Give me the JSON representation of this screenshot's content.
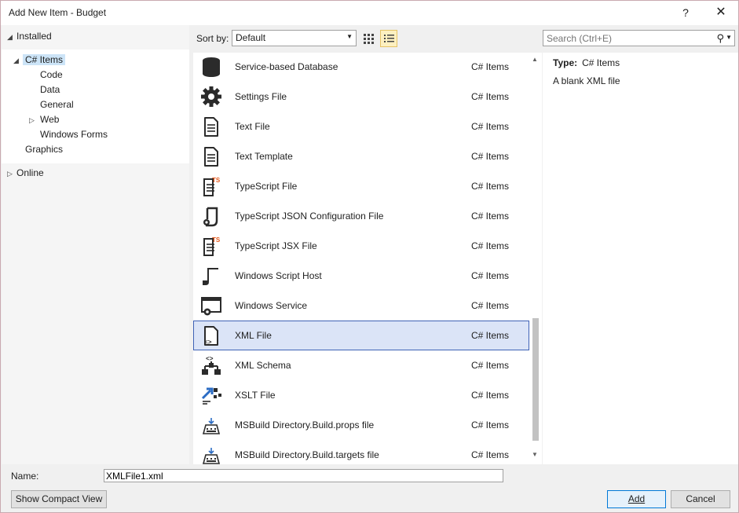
{
  "window": {
    "title": "Add New Item - Budget",
    "help": "?",
    "close": "✕"
  },
  "tree": {
    "installed": "Installed",
    "csharp_items": "C# Items",
    "children": [
      "Code",
      "Data",
      "General",
      "Web",
      "Windows Forms"
    ],
    "graphics": "Graphics",
    "online": "Online"
  },
  "toolbar": {
    "sort_label": "Sort by:",
    "sort_value": "Default",
    "search_placeholder": "Search (Ctrl+E)"
  },
  "items": [
    {
      "name": "Service-based Database",
      "category": "C# Items",
      "icon": "database-icon"
    },
    {
      "name": "Settings File",
      "category": "C# Items",
      "icon": "gear-icon"
    },
    {
      "name": "Text File",
      "category": "C# Items",
      "icon": "text-file-icon"
    },
    {
      "name": "Text Template",
      "category": "C# Items",
      "icon": "text-template-icon"
    },
    {
      "name": "TypeScript File",
      "category": "C# Items",
      "icon": "typescript-file-icon",
      "badge": "TS"
    },
    {
      "name": "TypeScript JSON Configuration File",
      "category": "C# Items",
      "icon": "json-config-icon"
    },
    {
      "name": "TypeScript JSX File",
      "category": "C# Items",
      "icon": "typescript-jsx-icon",
      "badge": "TS"
    },
    {
      "name": "Windows Script Host",
      "category": "C# Items",
      "icon": "script-host-icon"
    },
    {
      "name": "Windows Service",
      "category": "C# Items",
      "icon": "windows-service-icon"
    },
    {
      "name": "XML File",
      "category": "C# Items",
      "icon": "xml-file-icon",
      "selected": true
    },
    {
      "name": "XML Schema",
      "category": "C# Items",
      "icon": "xml-schema-icon"
    },
    {
      "name": "XSLT File",
      "category": "C# Items",
      "icon": "xslt-file-icon"
    },
    {
      "name": "MSBuild Directory.Build.props file",
      "category": "C# Items",
      "icon": "msbuild-props-icon"
    },
    {
      "name": "MSBuild Directory.Build.targets file",
      "category": "C# Items",
      "icon": "msbuild-targets-icon"
    }
  ],
  "details": {
    "type_label": "Type:",
    "type_value": "C# Items",
    "description": "A blank XML file"
  },
  "bottom": {
    "name_label": "Name:",
    "name_value": "XMLFile1.xml",
    "compact_view": "Show Compact View",
    "add": "Add",
    "cancel": "Cancel"
  },
  "colors": {
    "accent": "#0078d7",
    "selection": "#dbe4f7",
    "selection_border": "#3f62b6",
    "ts_badge": "#e65a1e"
  }
}
